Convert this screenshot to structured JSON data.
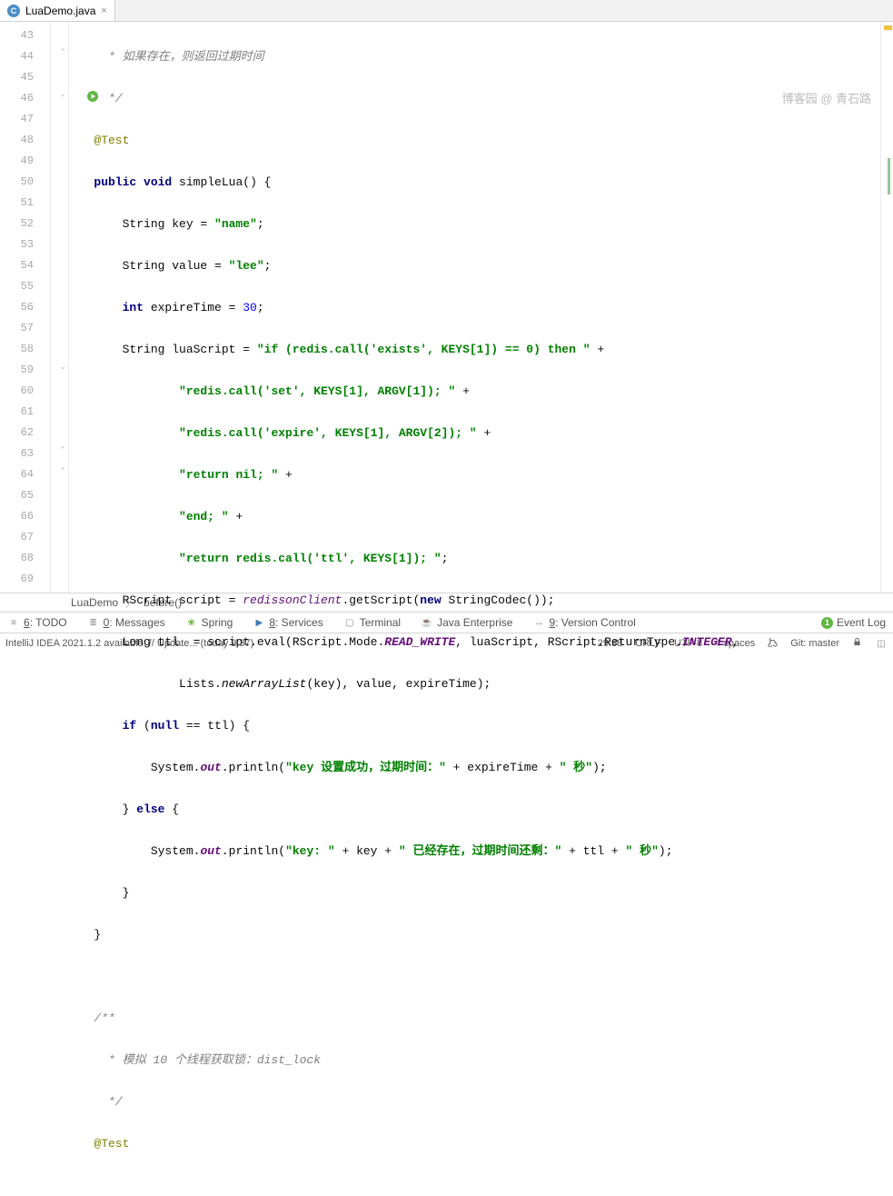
{
  "tab": {
    "filename": "LuaDemo.java"
  },
  "gutter": {
    "start": 43,
    "end": 69
  },
  "watermark": "博客园 @ 青石路",
  "code": {
    "l43": " * 如果存在，则返回过期时间",
    "l44": " */",
    "l45": "@Test",
    "l46_public": "public",
    "l46_void": "void",
    "l46_method": " simpleLua() {",
    "l47_a": "    String key = ",
    "l47_s": "\"name\"",
    "l47_e": ";",
    "l48_a": "    String value = ",
    "l48_s": "\"lee\"",
    "l48_e": ";",
    "l49_a": "    ",
    "l49_kw": "int",
    "l49_b": " expireTime = ",
    "l49_n": "30",
    "l49_e": ";",
    "l50_a": "    String luaScript = ",
    "l50_s": "\"if (redis.call('exists', KEYS[1]) == 0) then \"",
    "l50_e": " +",
    "l51_s": "\"redis.call('set', KEYS[1], ARGV[1]); \"",
    "l51_e": " +",
    "l52_s": "\"redis.call('expire', KEYS[1], ARGV[2]); \"",
    "l52_e": " +",
    "l53_s": "\"return nil; \"",
    "l53_e": " +",
    "l54_s": "\"end; \"",
    "l54_e": " +",
    "l55_s": "\"return redis.call('ttl', KEYS[1]); \"",
    "l55_e": ";",
    "l56_a": "    RScript script = ",
    "l56_f": "redissonClient",
    "l56_b": ".getScript(",
    "l56_kw": "new",
    "l56_c": " StringCodec());",
    "l57_a": "    Long ttl  = script.eval(RScript.Mode.",
    "l57_c": "READ_WRITE",
    "l57_b": ", luaScript, RScript.ReturnType.",
    "l57_c2": "INTEGER",
    "l57_e": ",",
    "l58_a": "            Lists.",
    "l58_m": "newArrayList",
    "l58_b": "(key), value, expireTime);",
    "l59_a": "    ",
    "l59_kw": "if",
    "l59_b": " (",
    "l59_kw2": "null",
    "l59_c": " == ttl) {",
    "l60_a": "        System.",
    "l60_f": "out",
    "l60_b": ".println(",
    "l60_s": "\"key 设置成功，过期时间：\"",
    "l60_c": " + expireTime + ",
    "l60_s2": "\" 秒\"",
    "l60_e": ");",
    "l61_a": "    } ",
    "l61_kw": "else",
    "l61_b": " {",
    "l62_a": "        System.",
    "l62_f": "out",
    "l62_b": ".println(",
    "l62_s": "\"key: \"",
    "l62_c": " + key + ",
    "l62_s2": "\" 已经存在，过期时间还剩：\"",
    "l62_d": " + ttl + ",
    "l62_s3": "\" 秒\"",
    "l62_e": ");",
    "l63": "    }",
    "l64": "}",
    "l66": "/**",
    "l67": " * 模拟 10 个线程获取锁：dist_lock",
    "l68": " */",
    "l69": "@Test"
  },
  "breadcrumb": {
    "cls": "LuaDemo",
    "method": "before()"
  },
  "toolwin": {
    "todo": "6: TODO",
    "messages": "0: Messages",
    "spring": "Spring",
    "services": "8: Services",
    "terminal": "Terminal",
    "javaee": "Java Enterprise",
    "version": "9: Version Control",
    "eventlog": "Event Log"
  },
  "status": {
    "update": "IntelliJ IDEA 2021.1.2 available: // Update... (today 9:37)",
    "pos": "29:38",
    "lineend": "CRLF",
    "encoding": "UTF-8",
    "indent": "4 spaces",
    "git": "Git: master"
  }
}
